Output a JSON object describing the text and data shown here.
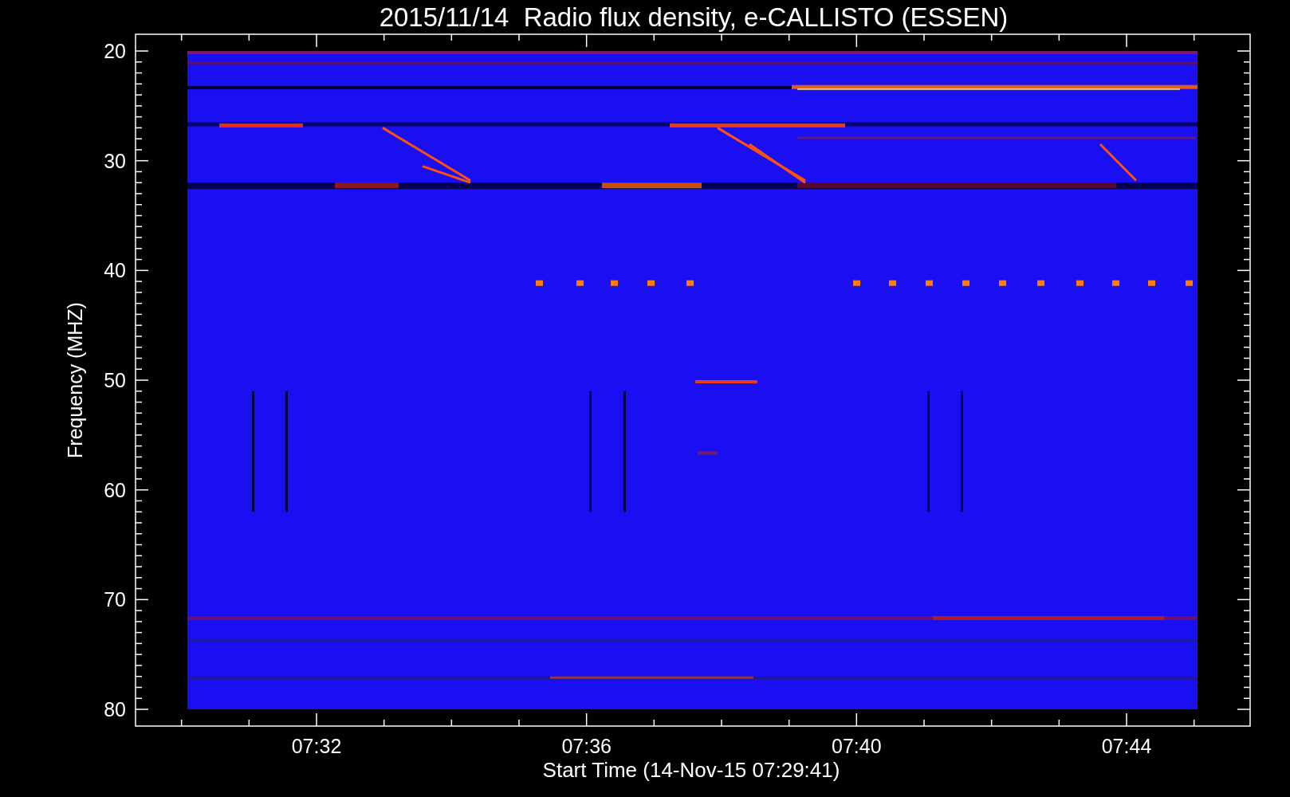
{
  "title": "2015/11/14  Radio flux density, e-CALLISTO (ESSEN)",
  "y_axis": {
    "label": "Frequency (MHZ)",
    "ticks": [
      "20",
      "30",
      "40",
      "50",
      "60",
      "70",
      "80"
    ]
  },
  "x_axis": {
    "label": "Start Time (14-Nov-15 07:29:41)",
    "ticks": [
      "07:32",
      "07:36",
      "07:40",
      "07:44"
    ]
  }
}
